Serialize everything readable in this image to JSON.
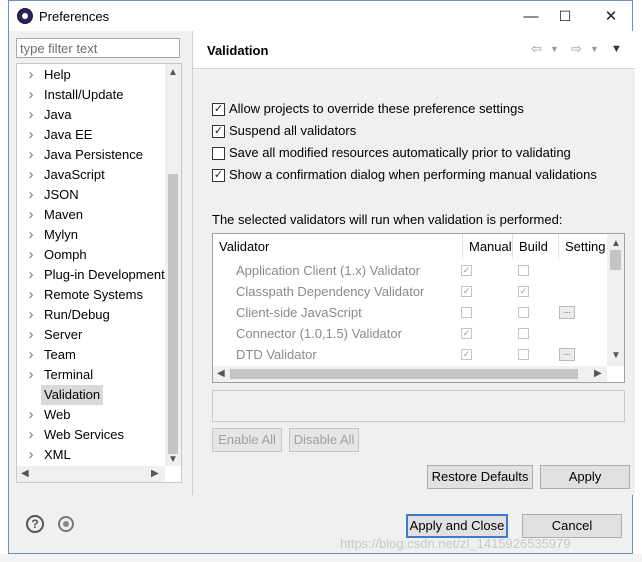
{
  "window": {
    "title": "Preferences",
    "minimize_glyph": "—",
    "maximize_glyph": "☐",
    "close_glyph": "✕"
  },
  "filter": {
    "placeholder": "type filter text"
  },
  "tree": {
    "items": [
      {
        "label": "Help",
        "expandable": true,
        "selected": false
      },
      {
        "label": "Install/Update",
        "expandable": true,
        "selected": false
      },
      {
        "label": "Java",
        "expandable": true,
        "selected": false
      },
      {
        "label": "Java EE",
        "expandable": true,
        "selected": false
      },
      {
        "label": "Java Persistence",
        "expandable": true,
        "selected": false
      },
      {
        "label": "JavaScript",
        "expandable": true,
        "selected": false
      },
      {
        "label": "JSON",
        "expandable": true,
        "selected": false
      },
      {
        "label": "Maven",
        "expandable": true,
        "selected": false
      },
      {
        "label": "Mylyn",
        "expandable": true,
        "selected": false
      },
      {
        "label": "Oomph",
        "expandable": true,
        "selected": false
      },
      {
        "label": "Plug-in Development",
        "expandable": true,
        "selected": false
      },
      {
        "label": "Remote Systems",
        "expandable": true,
        "selected": false
      },
      {
        "label": "Run/Debug",
        "expandable": true,
        "selected": false
      },
      {
        "label": "Server",
        "expandable": true,
        "selected": false
      },
      {
        "label": "Team",
        "expandable": true,
        "selected": false
      },
      {
        "label": "Terminal",
        "expandable": true,
        "selected": false
      },
      {
        "label": "Validation",
        "expandable": false,
        "selected": true
      },
      {
        "label": "Web",
        "expandable": true,
        "selected": false
      },
      {
        "label": "Web Services",
        "expandable": true,
        "selected": false
      },
      {
        "label": "XML",
        "expandable": true,
        "selected": false
      }
    ]
  },
  "page": {
    "title": "Validation",
    "options": [
      {
        "label": "Allow projects to override these preference settings",
        "checked": true
      },
      {
        "label": "Suspend all validators",
        "checked": true
      },
      {
        "label": "Save all modified resources automatically prior to validating",
        "checked": false
      },
      {
        "label": "Show a confirmation dialog when performing manual validations",
        "checked": true
      }
    ],
    "table_caption": "The selected validators will run when validation is performed:",
    "columns": [
      "Validator",
      "Manual",
      "Build",
      "Setting"
    ],
    "rows": [
      {
        "name": "Application Client (1.x) Validator",
        "manual": true,
        "build": false,
        "settings": false
      },
      {
        "name": "Classpath Dependency Validator",
        "manual": true,
        "build": true,
        "settings": false
      },
      {
        "name": "Client-side JavaScript",
        "manual": false,
        "build": false,
        "settings": true
      },
      {
        "name": "Connector (1.0,1.5) Validator",
        "manual": true,
        "build": false,
        "settings": false
      },
      {
        "name": "DTD Validator",
        "manual": true,
        "build": false,
        "settings": true
      }
    ],
    "enable_all": "Enable All",
    "disable_all": "Disable All",
    "restore_defaults": "Restore Defaults",
    "apply": "Apply"
  },
  "footer": {
    "apply_and_close": "Apply and Close",
    "cancel": "Cancel"
  },
  "watermark": "https://blog.csdn.net/zl_1415926535979"
}
